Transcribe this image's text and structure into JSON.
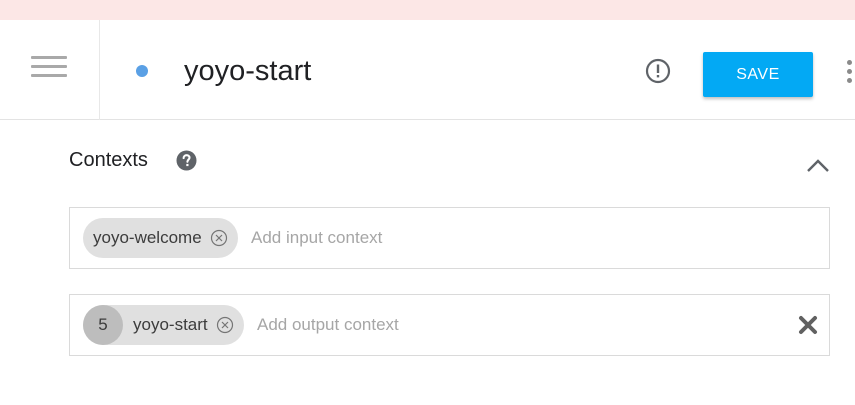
{
  "header": {
    "intent_name": "yoyo-start",
    "save_label": "SAVE"
  },
  "contexts": {
    "title": "Contexts",
    "input": {
      "chips": [
        {
          "name": "yoyo-welcome"
        }
      ],
      "placeholder": "Add input context"
    },
    "output": {
      "chips": [
        {
          "lifespan": "5",
          "name": "yoyo-start"
        }
      ],
      "placeholder": "Add output context"
    }
  },
  "colors": {
    "banner": "#fce7e6",
    "save_button": "#03a9f4",
    "status_dot": "#5aa0e5",
    "chip": "#e0e0e0"
  },
  "icons": [
    "menu-icon",
    "status-dot",
    "alert-icon",
    "more-vertical-icon",
    "help-icon",
    "chevron-up-icon",
    "chip-remove-icon",
    "clear-icon"
  ]
}
